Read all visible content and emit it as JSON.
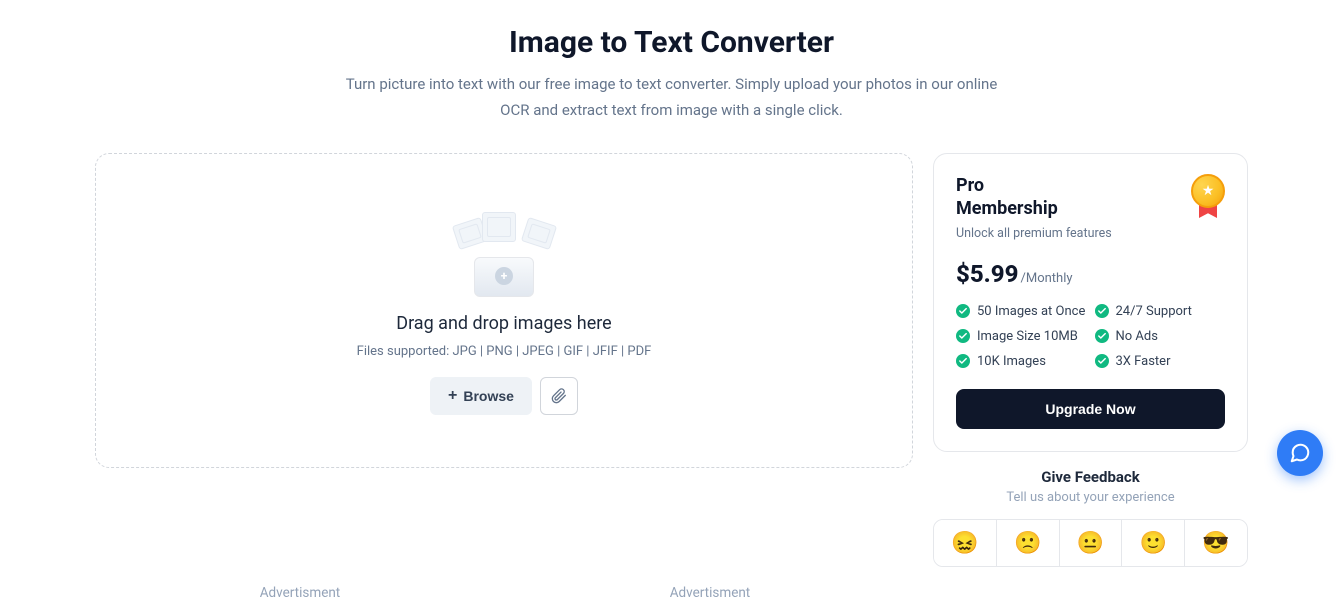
{
  "header": {
    "title": "Image to Text Converter",
    "subtitle": "Turn picture into text with our free image to text converter. Simply upload your photos in our online OCR and extract text from image with a single click."
  },
  "upload": {
    "dnd_text": "Drag and drop images here",
    "supported_text": "Files supported: JPG | PNG | JPEG | GIF | JFIF | PDF",
    "browse_label": "Browse"
  },
  "pro": {
    "title_line1": "Pro",
    "title_line2": "Membership",
    "subtitle": "Unlock all premium features",
    "price": "$5.99",
    "period": "/Monthly",
    "features": [
      "50 Images at Once",
      "24/7 Support",
      "Image Size 10MB",
      "No Ads",
      "10K Images",
      "3X Faster"
    ],
    "upgrade_label": "Upgrade Now"
  },
  "feedback": {
    "title": "Give Feedback",
    "subtitle": "Tell us about your experience",
    "emojis": [
      "😖",
      "🙁",
      "😐",
      "🙂",
      "😎"
    ]
  },
  "ads": {
    "label": "Advertisment"
  },
  "icons": {
    "medal_star": "★"
  }
}
